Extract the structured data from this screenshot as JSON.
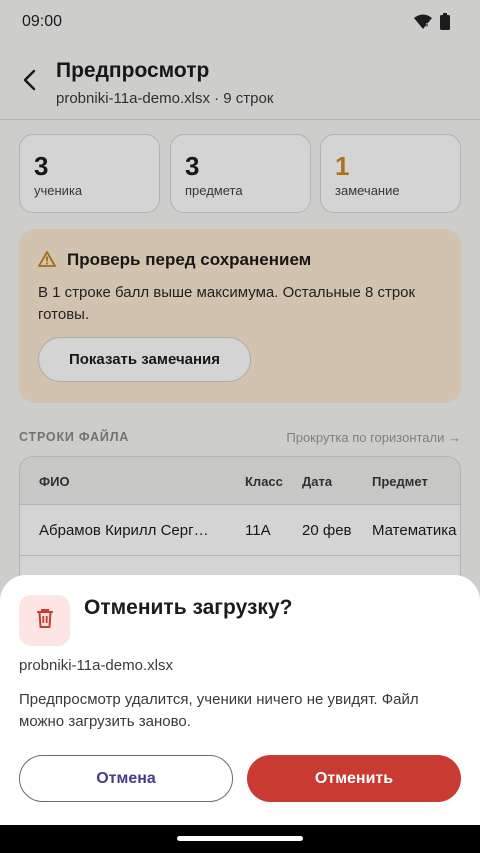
{
  "status_bar": {
    "time": "09:00"
  },
  "header": {
    "title": "Предпросмотр",
    "subtitle": "probniki-11a-demo.xlsx · 9 строк"
  },
  "stats": [
    {
      "value": "3",
      "label": "ученика",
      "color": "#1c1c1c"
    },
    {
      "value": "3",
      "label": "предмета",
      "color": "#1c1c1c"
    },
    {
      "value": "1",
      "label": "замечание",
      "color": "#D08A1E"
    }
  ],
  "warning": {
    "title": "Проверь перед сохранением",
    "text": "В 1 строке балл выше максимума. Остальные 8 строк готовы.",
    "button": "Показать замечания"
  },
  "file_rows": {
    "section_title": "СТРОКИ ФАЙЛА",
    "scroll_hint": "Прокрутка по горизонтали →",
    "columns": [
      "ФИО",
      "Класс",
      "Дата",
      "Предмет"
    ],
    "rows": [
      [
        "Абрамов Кирилл Серг…",
        "11А",
        "20 фев",
        "Математика"
      ]
    ]
  },
  "sheet": {
    "title": "Отменить загрузку?",
    "file": "probniki-11a-demo.xlsx",
    "text": "Предпросмотр удалится, ученики ничего не увидят. Файл можно загрузить заново.",
    "cancel_label": "Отмена",
    "confirm_label": "Отменить",
    "icon": "trash-icon"
  },
  "colors": {
    "accent_danger": "#C83A32",
    "warning_bg": "#FCEBD3",
    "warning_accent": "#D08A1E"
  }
}
